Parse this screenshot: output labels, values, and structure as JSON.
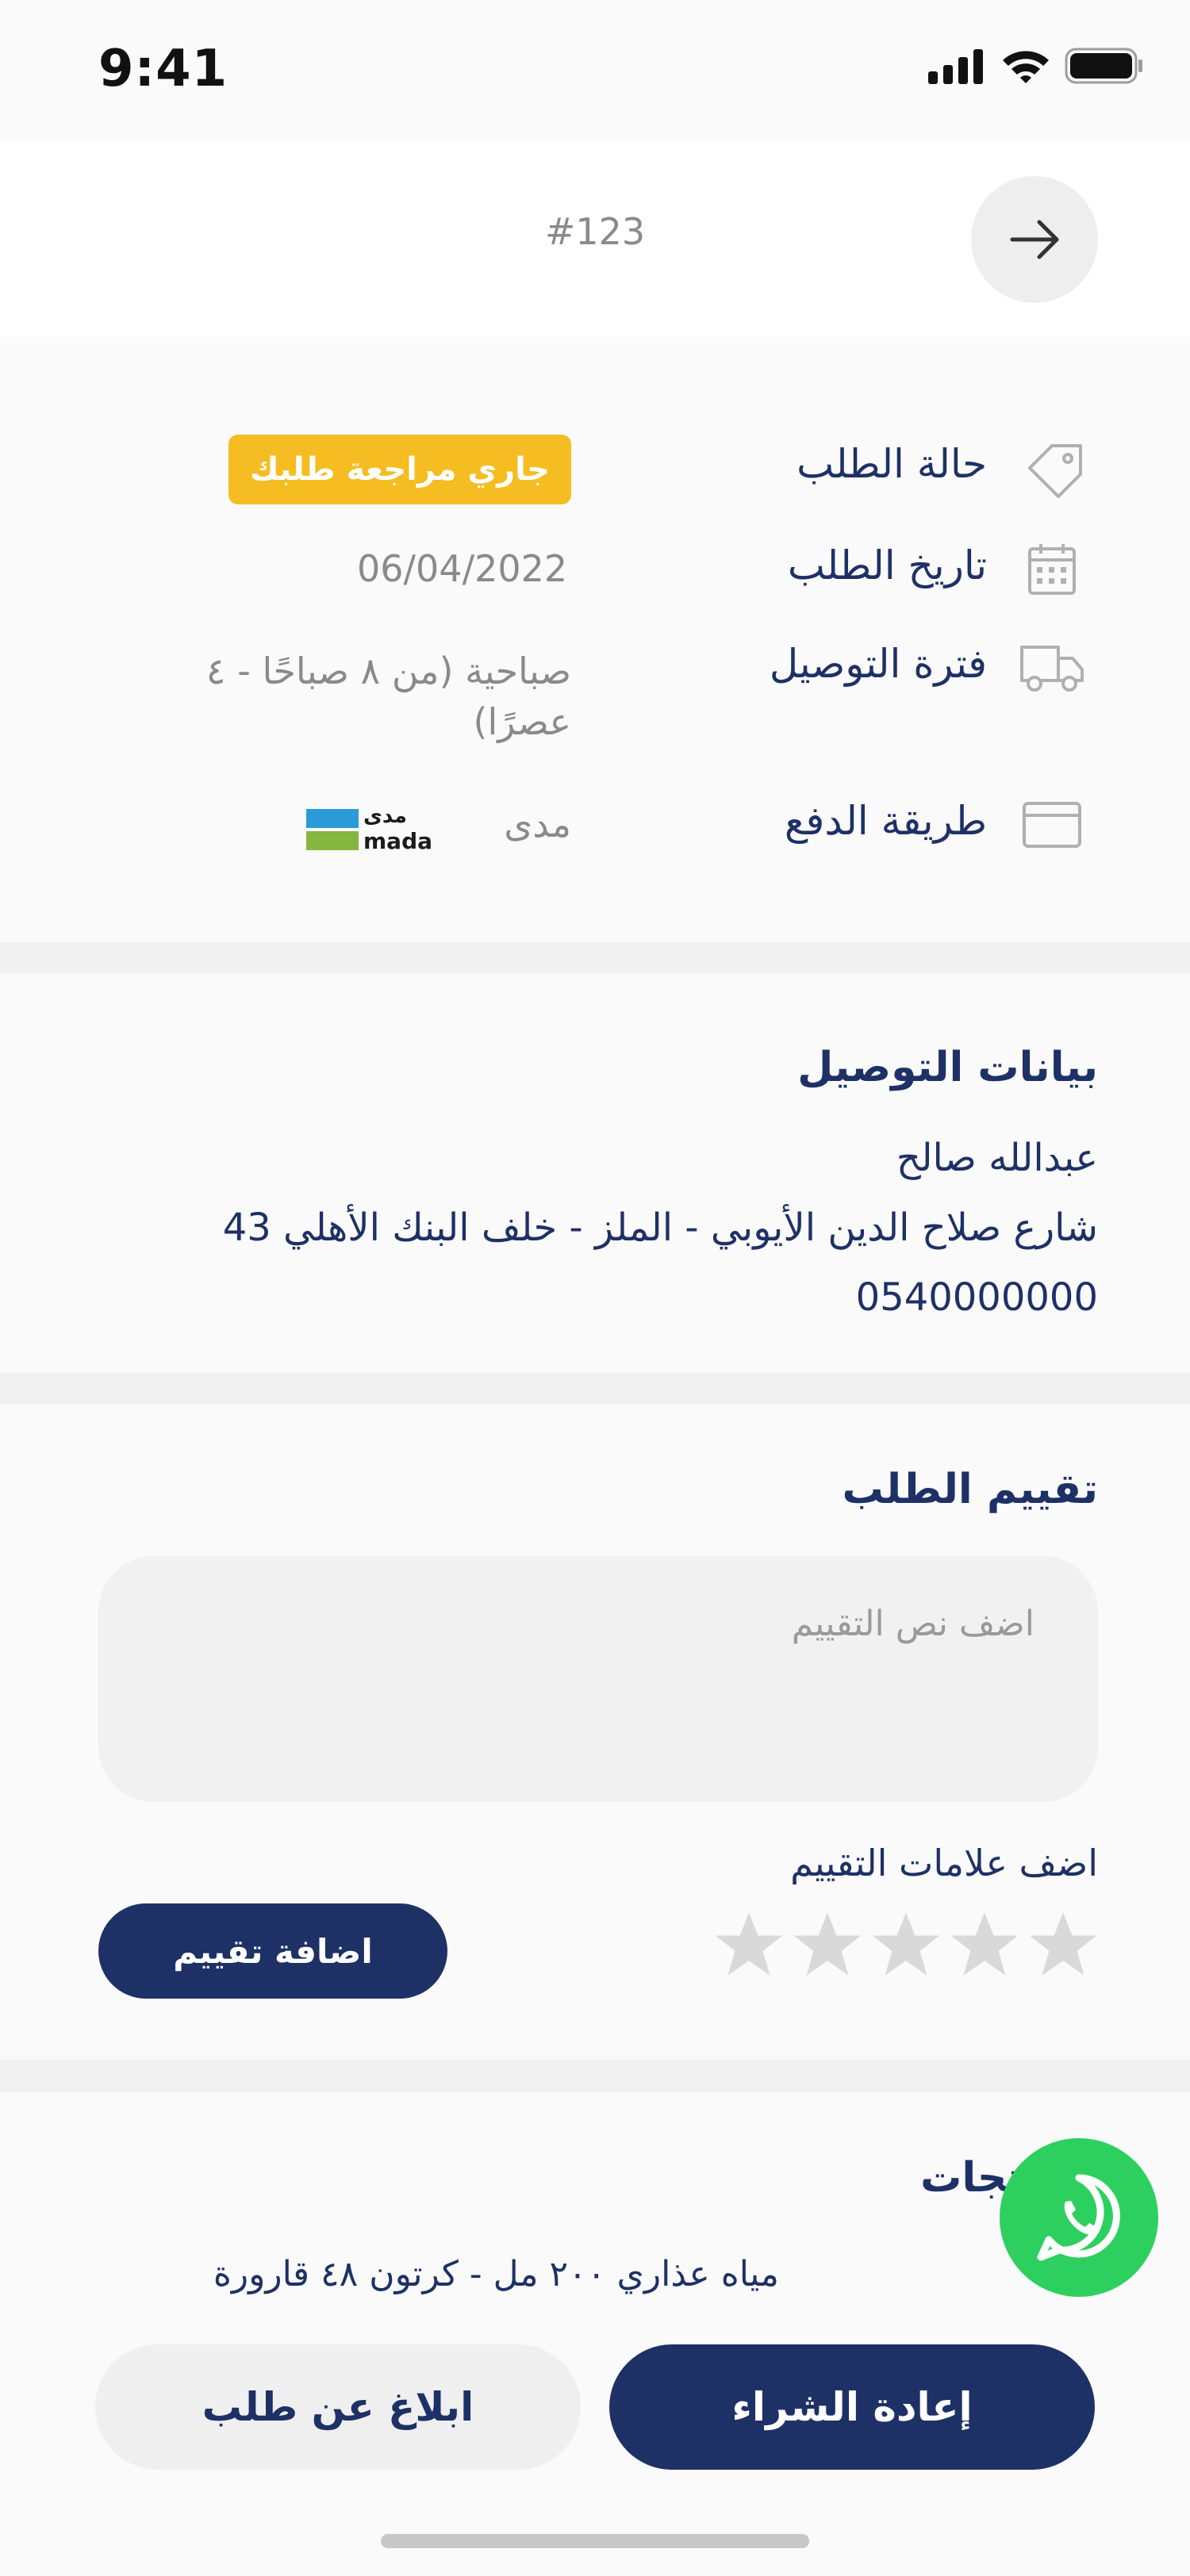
{
  "status_bar": {
    "time": "9:41"
  },
  "header": {
    "order_number": "#123"
  },
  "order_info": {
    "status_label": "حالة الطلب",
    "status_badge": "جاري مراجعة طلبك",
    "date_label": "تاريخ الطلب",
    "date_value": "06/04/2022",
    "delivery_label": "فترة التوصيل",
    "delivery_value_line1": "صباحية (من ٨ صباحًا - ٤",
    "delivery_value_line2": "عصرًا)",
    "payment_label": "طريقة الدفع",
    "payment_value": "مدى",
    "mada_logo_ar": "مدى",
    "mada_logo_en": "mada"
  },
  "delivery_details": {
    "title": "بيانات التوصيل",
    "name": "عبدالله صالح",
    "address": "شارع صلاح الدين الأيوبي - الملز - خلف البنك الأهلي 43",
    "phone": "0540000000"
  },
  "rating": {
    "title": "تقييم الطلب",
    "textarea_placeholder": "اضف نص التقييم",
    "stars_label": "اضف علامات التقييم",
    "stars_selected": 0,
    "stars_total": 5,
    "submit_label": "اضافة تقييم"
  },
  "products": {
    "title": "المنتجات",
    "items": [
      {
        "name": "مياه عذاري ٢٠٠ مل - كرتون ٤٨ قارورة"
      }
    ]
  },
  "actions": {
    "reorder_label": "إعادة الشراء",
    "report_label": "ابلاغ عن طلب"
  },
  "colors": {
    "navy": "#1e3166",
    "badge_yellow": "#f5bd22",
    "whatsapp_green": "#2dd05f"
  },
  "icons": [
    "signal-icon",
    "wifi-icon",
    "battery-icon",
    "arrow-right-icon",
    "tag-icon",
    "calendar-icon",
    "truck-icon",
    "card-icon",
    "star-icon",
    "whatsapp-icon"
  ]
}
